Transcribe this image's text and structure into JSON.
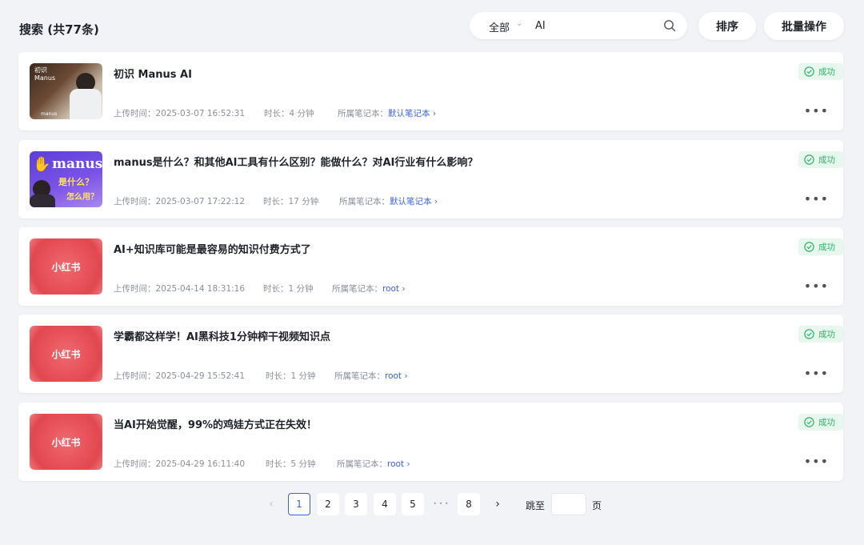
{
  "header": {
    "title": "搜索 (共77条)",
    "filter_value": "全部",
    "search_value": "AI",
    "sort_label": "排序",
    "batch_label": "批量操作"
  },
  "meta_labels": {
    "upload": "上传时间：",
    "duration": "时长：",
    "notebook": "所属笔记本："
  },
  "items": [
    {
      "title": "初识 Manus AI",
      "upload_time": "2025-03-07 16:52:31",
      "duration": "4 分钟",
      "notebook": "默认笔记本",
      "status": "成功",
      "thumb": "manus-video",
      "thumb_text": [
        "初识",
        "Manus",
        "manus"
      ]
    },
    {
      "title": "manus是什么？和其他AI工具有什么区别？能做什么？对AI行业有什么影响？",
      "upload_time": "2025-03-07 17:22:12",
      "duration": "17 分钟",
      "notebook": "默认笔记本",
      "status": "成功",
      "thumb": "manus-cover",
      "thumb_text": [
        "manus",
        "是什么？",
        "怎么用？"
      ]
    },
    {
      "title": "AI+知识库可能是最容易的知识付费方式了",
      "upload_time": "2025-04-14 18:31:16",
      "duration": "1 分钟",
      "notebook": "root",
      "status": "成功",
      "thumb": "xiaohongshu",
      "thumb_text": [
        "小红书"
      ]
    },
    {
      "title": "学霸都这样学！AI黑科技1分钟榨干视频知识点",
      "upload_time": "2025-04-29 15:52:41",
      "duration": "1 分钟",
      "notebook": "root",
      "status": "成功",
      "thumb": "xiaohongshu",
      "thumb_text": [
        "小红书"
      ]
    },
    {
      "title": "当AI开始觉醒，99%的鸡娃方式正在失效！",
      "upload_time": "2025-04-29 16:11:40",
      "duration": "5 分钟",
      "notebook": "root",
      "status": "成功",
      "thumb": "xiaohongshu",
      "thumb_text": [
        "小红书"
      ]
    }
  ],
  "pagination": {
    "prev": "‹",
    "pages": [
      "1",
      "2",
      "3",
      "4",
      "5"
    ],
    "ellipsis": "• • •",
    "last": "8",
    "next": "›",
    "current": "1",
    "jump_label": "跳至",
    "jump_suffix": "页"
  },
  "colors": {
    "accent": "#3a62d9",
    "success": "#2fb36a",
    "success_bg": "#e8f7ee",
    "background": "#f2f3f6"
  }
}
